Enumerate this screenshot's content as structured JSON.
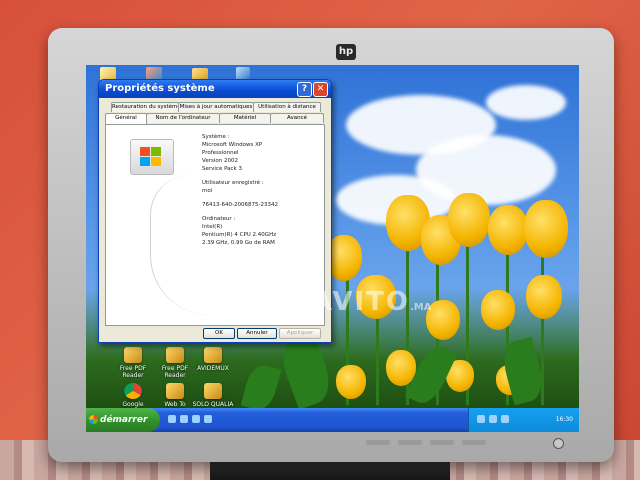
{
  "monitor": {
    "brand": "hp"
  },
  "watermark": {
    "text": "AVITO",
    "suffix": ".MA"
  },
  "desktop_icons": [
    {
      "label": "Free PDF Reader"
    },
    {
      "label": "Free PDF Reader"
    },
    {
      "label": "AVIDEMUX"
    },
    {
      "label": "Google Chrome"
    },
    {
      "label": "Web To WORD"
    },
    {
      "label": "SOLO QUALIA"
    }
  ],
  "dialog": {
    "title": "Propriétés système",
    "tabs_top": [
      "Restauration du système",
      "Mises à jour automatiques",
      "Utilisation à distance"
    ],
    "tabs_bottom": [
      "Général",
      "Nom de l'ordinateur",
      "Matériel",
      "Avancé"
    ],
    "system_label": "Système :",
    "os": "Microsoft Windows XP",
    "edition": "Professionnel",
    "version": "Version 2002",
    "service_pack": "Service Pack 3",
    "registered_label": "Utilisateur enregistré :",
    "user": "moi",
    "product_id": "76413-640-2006875-23342",
    "computer_label": "Ordinateur :",
    "cpu_vendor": "Intel(R)",
    "cpu": "Pentium(R) 4 CPU 2.40GHz",
    "ram": "2.39 GHz, 0.99 Go de RAM",
    "ok": "OK",
    "cancel": "Annuler",
    "apply": "Appliquer"
  },
  "taskbar": {
    "start_label": "démarrer",
    "clock": "16:30"
  }
}
